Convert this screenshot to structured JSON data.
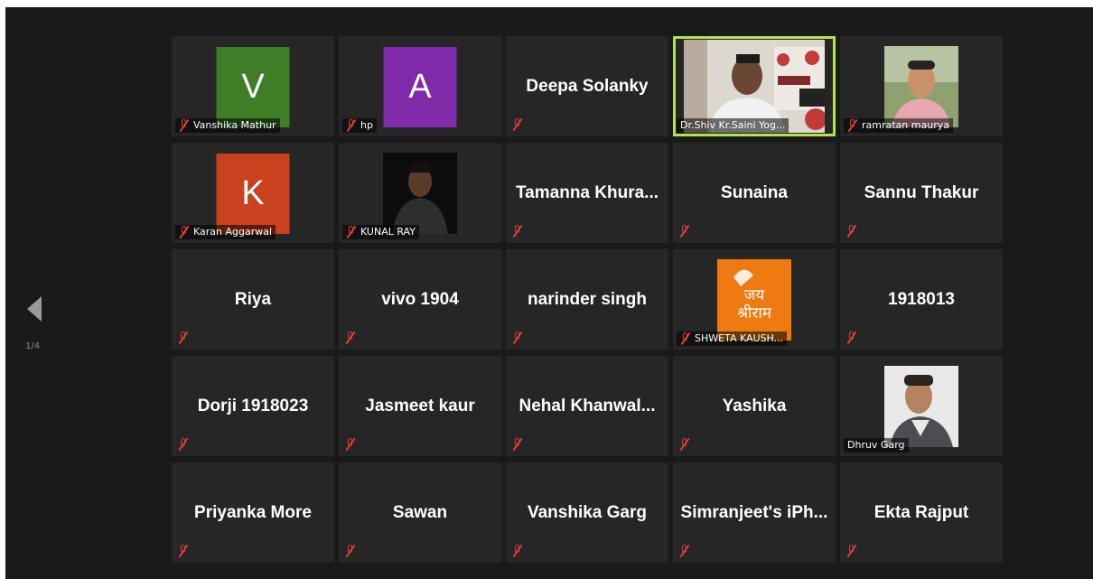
{
  "pager": {
    "label": "1/4"
  },
  "colors": {
    "accent_border": "#b4e24a",
    "muted_icon": "#e23c3c",
    "tile_bg": "#262626",
    "screen_bg": "#1a1a1a"
  },
  "tiles": [
    {
      "label": "Vanshika Mathur",
      "avatar_letter": "V",
      "avatar_color": "#3f7d27",
      "kind": "avatar"
    },
    {
      "label": "hp",
      "avatar_letter": "A",
      "avatar_color": "#7f2aa8",
      "kind": "avatar"
    },
    {
      "label": "Deepa Solanky",
      "kind": "name"
    },
    {
      "label": "Dr.Shiv Kr.Saini Yog...",
      "kind": "video",
      "active": true
    },
    {
      "label": "ramratan maurya",
      "kind": "photo"
    },
    {
      "label": "Karan Aggarwal",
      "avatar_letter": "K",
      "avatar_color": "#c9411d",
      "kind": "avatar"
    },
    {
      "label": "KUNAL RAY",
      "kind": "photo"
    },
    {
      "label": "Tamanna Khura...",
      "kind": "name"
    },
    {
      "label": "Sunaina",
      "kind": "name"
    },
    {
      "label": "Sannu Thakur",
      "kind": "name"
    },
    {
      "label": "Riya",
      "kind": "name"
    },
    {
      "label": "vivo 1904",
      "kind": "name"
    },
    {
      "label": "narinder singh",
      "kind": "name"
    },
    {
      "label": "SHWETA KAUSH...",
      "kind": "photo",
      "image_text": "जय श्रीराम"
    },
    {
      "label": "1918013",
      "kind": "name"
    },
    {
      "label": "Dorji 1918023",
      "kind": "name"
    },
    {
      "label": "Jasmeet kaur",
      "kind": "name"
    },
    {
      "label": "Nehal Khanwal...",
      "kind": "name"
    },
    {
      "label": "Yashika",
      "kind": "name"
    },
    {
      "label": "Dhruv Garg",
      "kind": "photo"
    },
    {
      "label": "Priyanka More",
      "kind": "name"
    },
    {
      "label": "Sawan",
      "kind": "name"
    },
    {
      "label": "Vanshika Garg",
      "kind": "name"
    },
    {
      "label": "Simranjeet's iPh...",
      "kind": "name"
    },
    {
      "label": "Ekta Rajput",
      "kind": "name"
    }
  ]
}
